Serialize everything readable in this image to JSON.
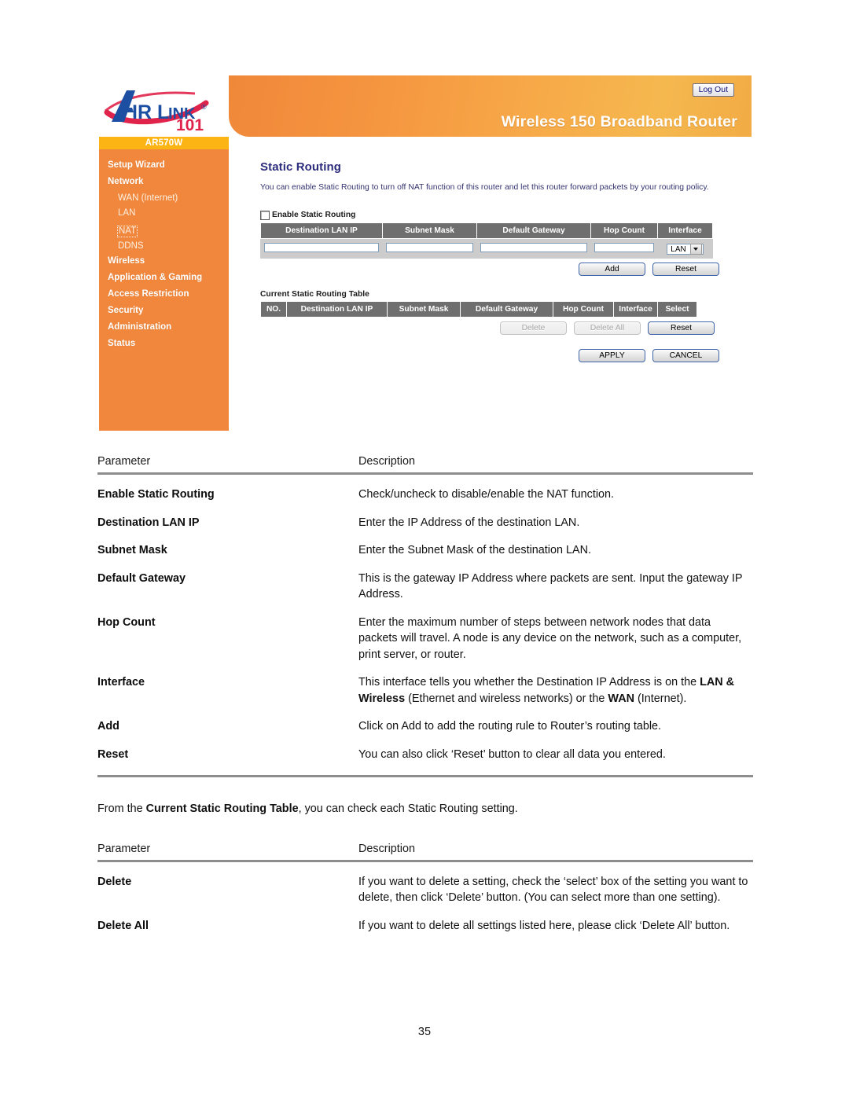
{
  "router_ui": {
    "logo": {
      "brand": "AIRLINK",
      "brand_suffix": "101",
      "trademark": "®"
    },
    "model_band": "AR570W",
    "banner": {
      "title": "Wireless 150 Broadband Router",
      "logout_label": "Log Out"
    },
    "sidebar": [
      {
        "label": "Setup Wizard",
        "level": "top",
        "state": "normal"
      },
      {
        "label": "Network",
        "level": "top",
        "state": "normal"
      },
      {
        "label": "WAN (Internet)",
        "level": "sub",
        "state": "normal"
      },
      {
        "label": "LAN",
        "level": "sub",
        "state": "normal"
      },
      {
        "label": "NAT",
        "level": "sub",
        "state": "focused"
      },
      {
        "label": "DDNS",
        "level": "sub",
        "state": "normal"
      },
      {
        "label": "Wireless",
        "level": "top",
        "state": "normal"
      },
      {
        "label": "Application & Gaming",
        "level": "top",
        "state": "normal"
      },
      {
        "label": "Access Restriction",
        "level": "top",
        "state": "normal"
      },
      {
        "label": "Security",
        "level": "top",
        "state": "normal"
      },
      {
        "label": "Administration",
        "level": "top",
        "state": "normal"
      },
      {
        "label": "Status",
        "level": "top",
        "state": "normal"
      }
    ],
    "page": {
      "title": "Static Routing",
      "description": "You can enable Static Routing to turn off NAT function of this router and let this router forward packets by your routing policy.",
      "enable_checkbox_label": "Enable Static Routing",
      "enable_checkbox_checked": false
    },
    "entry_table": {
      "headers": [
        "Destination LAN IP",
        "Subnet Mask",
        "Default Gateway",
        "Hop Count",
        "Interface"
      ],
      "values": {
        "destination_lan_ip": "",
        "subnet_mask": "",
        "default_gateway": "",
        "hop_count": "",
        "interface_selected": "LAN"
      }
    },
    "entry_buttons": [
      {
        "label": "Add",
        "enabled": true
      },
      {
        "label": "Reset",
        "enabled": true
      }
    ],
    "current_table": {
      "caption": "Current Static Routing Table",
      "headers": [
        "NO.",
        "Destination LAN IP",
        "Subnet Mask",
        "Default Gateway",
        "Hop Count",
        "Interface",
        "Select"
      ],
      "rows": []
    },
    "table_buttons": [
      {
        "label": "Delete",
        "enabled": false
      },
      {
        "label": "Delete All",
        "enabled": false
      },
      {
        "label": "Reset",
        "enabled": true
      }
    ],
    "footer_buttons": [
      {
        "label": "APPLY",
        "enabled": true
      },
      {
        "label": "CANCEL",
        "enabled": true
      }
    ],
    "colors": {
      "sidebar_orange": "#f0873c",
      "model_band_amber": "#fcb415",
      "title_navy": "#2c2c7c",
      "table_header_grey": "#6f6f6f"
    }
  },
  "doc": {
    "table1": {
      "col_parameter": "Parameter",
      "col_description": "Description",
      "rows": [
        {
          "parameter": "Enable Static Routing",
          "description": "Check/uncheck to disable/enable the NAT function."
        },
        {
          "parameter": "Destination LAN IP",
          "description": "Enter the IP Address of the destination LAN."
        },
        {
          "parameter": "Subnet Mask",
          "description": "Enter the Subnet Mask of the destination LAN."
        },
        {
          "parameter": "Default Gateway",
          "description": "This is the gateway IP Address where packets are sent. Input the gateway IP Address."
        },
        {
          "parameter": "Hop Count",
          "description": "Enter the maximum number of steps between network nodes that data packets will travel. A node is any device on the network, such as a computer, print server, or router."
        },
        {
          "parameter": "Interface",
          "description_part1": "This interface tells you whether the Destination IP Address is on the ",
          "description_bold1": "LAN & Wireless",
          "description_part2": " (Ethernet and wireless networks) or the ",
          "description_bold2": "WAN",
          "description_part3": " (Internet)."
        },
        {
          "parameter": "Add",
          "description": "Click on Add to add the routing rule to Router’s routing table."
        },
        {
          "parameter": "Reset",
          "description": "You can also click ‘Reset’ button to clear all data you entered."
        }
      ]
    },
    "middle_paragraph": {
      "part1": "From the ",
      "bold": "Current Static Routing Table",
      "part2": ", you can check each Static Routing setting."
    },
    "table2": {
      "col_parameter": "Parameter",
      "col_description": "Description",
      "rows": [
        {
          "parameter": "Delete",
          "description": "If you want to delete a setting, check the ‘select’ box of the setting you want to delete, then click ‘Delete’ button. (You can select more than one setting)."
        },
        {
          "parameter": "Delete All",
          "description": "If you want to delete all settings listed here, please click ‘Delete All’ button."
        }
      ]
    },
    "page_number": "35"
  }
}
